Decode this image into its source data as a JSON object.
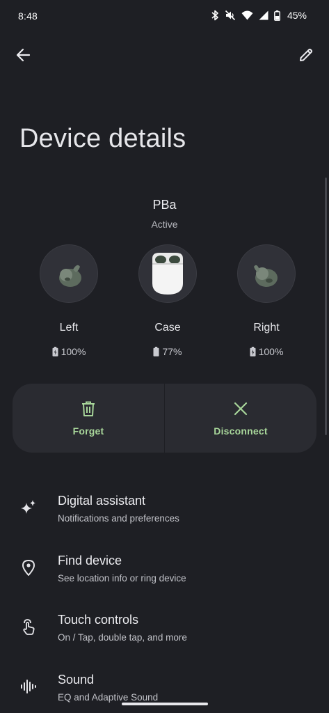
{
  "status_bar": {
    "time": "8:48",
    "battery": "45%",
    "icons": [
      "bluetooth-icon",
      "mute-icon",
      "wifi-icon",
      "signal-icon",
      "battery-icon"
    ]
  },
  "app_bar": {
    "back_icon": "arrow-back-icon",
    "edit_icon": "pencil-icon"
  },
  "page": {
    "title": "Device details"
  },
  "device": {
    "name": "PBa",
    "status": "Active",
    "components": [
      {
        "label": "Left",
        "battery": "100%",
        "charging": true
      },
      {
        "label": "Case",
        "battery": "77%",
        "charging": false
      },
      {
        "label": "Right",
        "battery": "100%",
        "charging": true
      }
    ]
  },
  "actions": {
    "forget": "Forget",
    "disconnect": "Disconnect"
  },
  "settings": [
    {
      "title": "Digital assistant",
      "subtitle": "Notifications and preferences",
      "icon": "sparkle-icon"
    },
    {
      "title": "Find device",
      "subtitle": "See location info or ring device",
      "icon": "location-pin-icon"
    },
    {
      "title": "Touch controls",
      "subtitle": "On / Tap, double tap, and more",
      "icon": "touch-icon"
    },
    {
      "title": "Sound",
      "subtitle": "EQ and Adaptive Sound",
      "icon": "sound-wave-icon"
    }
  ],
  "colors": {
    "background": "#1e1f24",
    "card": "#2a2b31",
    "accent": "#a8d69a"
  }
}
